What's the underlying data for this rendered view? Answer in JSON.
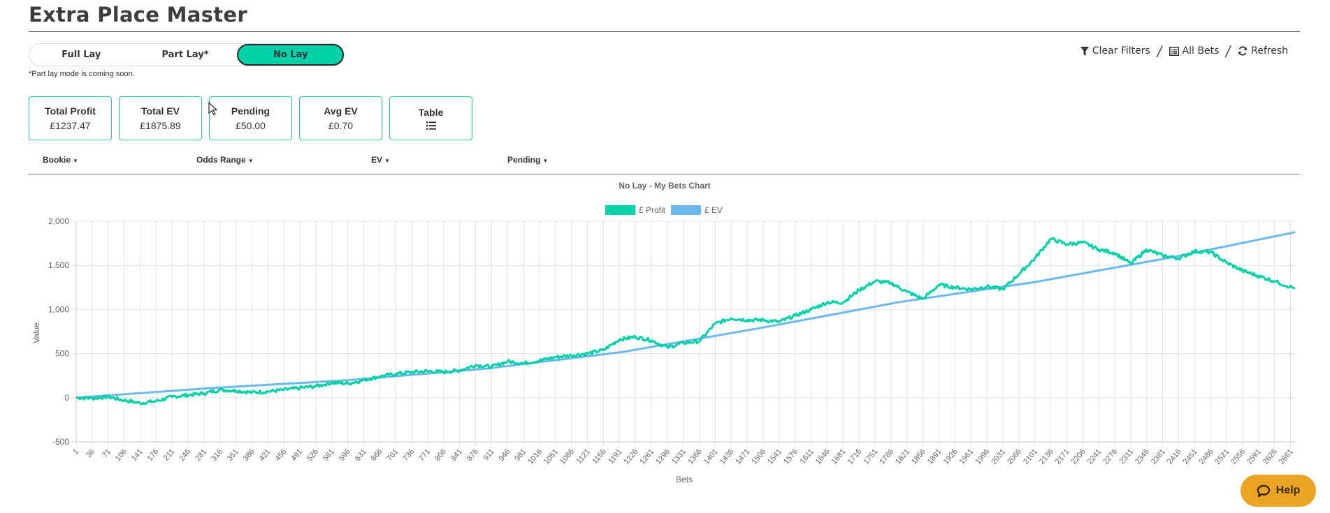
{
  "header": {
    "title": "Extra Place Master"
  },
  "modes": {
    "items": [
      {
        "label": "Full Lay",
        "active": false
      },
      {
        "label": "Part Lay*",
        "active": false
      },
      {
        "label": "No Lay",
        "active": true
      }
    ],
    "note": "*Part lay mode is coming soon."
  },
  "actions": {
    "clear_filters": "Clear Filters",
    "all_bets": "All Bets",
    "refresh": "Refresh",
    "separator": "/"
  },
  "stats": [
    {
      "label": "Total Profit",
      "value": "£1237.47"
    },
    {
      "label": "Total EV",
      "value": "£1875.89"
    },
    {
      "label": "Pending",
      "value": "£50.00"
    },
    {
      "label": "Avg EV",
      "value": "£0.70"
    },
    {
      "label": "Table",
      "value": "list-icon"
    }
  ],
  "filters": [
    "Bookie",
    "Odds Range",
    "EV",
    "Pending"
  ],
  "help": {
    "label": "Help"
  },
  "colors": {
    "accent": "#00d1a7",
    "ev": "#6cb8ec",
    "help": "#eba323"
  },
  "chart_data": {
    "type": "line",
    "title": "No Lay - My Bets Chart",
    "xlabel": "Bets",
    "ylabel": "Value",
    "ylim": [
      -500,
      2000
    ],
    "yticks": [
      2000,
      1500,
      1000,
      500,
      0,
      -500
    ],
    "ytick_labels": [
      "2,000",
      "1,500",
      "1,000",
      "500",
      "0",
      "-500"
    ],
    "x_range": [
      1,
      2671
    ],
    "xticks": [
      1,
      36,
      71,
      106,
      141,
      176,
      211,
      246,
      281,
      316,
      351,
      386,
      421,
      456,
      491,
      526,
      561,
      596,
      631,
      666,
      701,
      736,
      771,
      806,
      841,
      876,
      911,
      946,
      981,
      1016,
      1051,
      1086,
      1121,
      1156,
      1191,
      1226,
      1261,
      1296,
      1331,
      1366,
      1401,
      1436,
      1471,
      1506,
      1541,
      1576,
      1611,
      1646,
      1681,
      1716,
      1751,
      1786,
      1821,
      1856,
      1891,
      1926,
      1961,
      1996,
      2031,
      2066,
      2101,
      2136,
      2171,
      2206,
      2241,
      2276,
      2311,
      2346,
      2381,
      2416,
      2451,
      2486,
      2521,
      2556,
      2591,
      2626,
      2661
    ],
    "grid": true,
    "legend_position": "top-center",
    "series": [
      {
        "name": "£ Profit",
        "color": "#00d1a7",
        "x": [
          1,
          36,
          71,
          106,
          141,
          176,
          211,
          246,
          281,
          316,
          351,
          386,
          421,
          456,
          491,
          526,
          561,
          596,
          631,
          666,
          701,
          736,
          771,
          806,
          841,
          876,
          911,
          946,
          981,
          1016,
          1051,
          1086,
          1121,
          1156,
          1191,
          1226,
          1261,
          1296,
          1331,
          1366,
          1401,
          1436,
          1471,
          1506,
          1541,
          1576,
          1611,
          1646,
          1681,
          1716,
          1751,
          1786,
          1821,
          1856,
          1891,
          1926,
          1961,
          1996,
          2031,
          2066,
          2101,
          2136,
          2171,
          2206,
          2241,
          2276,
          2311,
          2346,
          2381,
          2416,
          2451,
          2486,
          2521,
          2556,
          2591,
          2626,
          2671
        ],
        "values": [
          0,
          -5,
          10,
          -30,
          -60,
          -40,
          10,
          30,
          50,
          90,
          80,
          60,
          70,
          90,
          110,
          130,
          170,
          160,
          200,
          240,
          270,
          290,
          300,
          290,
          310,
          370,
          350,
          410,
          390,
          420,
          460,
          480,
          500,
          540,
          660,
          690,
          650,
          570,
          620,
          640,
          840,
          900,
          880,
          880,
          860,
          930,
          1000,
          1080,
          1080,
          1220,
          1320,
          1300,
          1200,
          1120,
          1280,
          1250,
          1230,
          1260,
          1230,
          1400,
          1580,
          1800,
          1740,
          1760,
          1680,
          1640,
          1520,
          1680,
          1610,
          1580,
          1660,
          1650,
          1530,
          1440,
          1380,
          1320,
          1237.47
        ]
      },
      {
        "name": "£ EV",
        "color": "#6cb8ec",
        "x": [
          1,
          300,
          600,
          900,
          1200,
          1500,
          1800,
          2100,
          2400,
          2671
        ],
        "values": [
          0,
          110,
          200,
          330,
          520,
          790,
          1080,
          1310,
          1590,
          1875.89
        ]
      }
    ]
  }
}
